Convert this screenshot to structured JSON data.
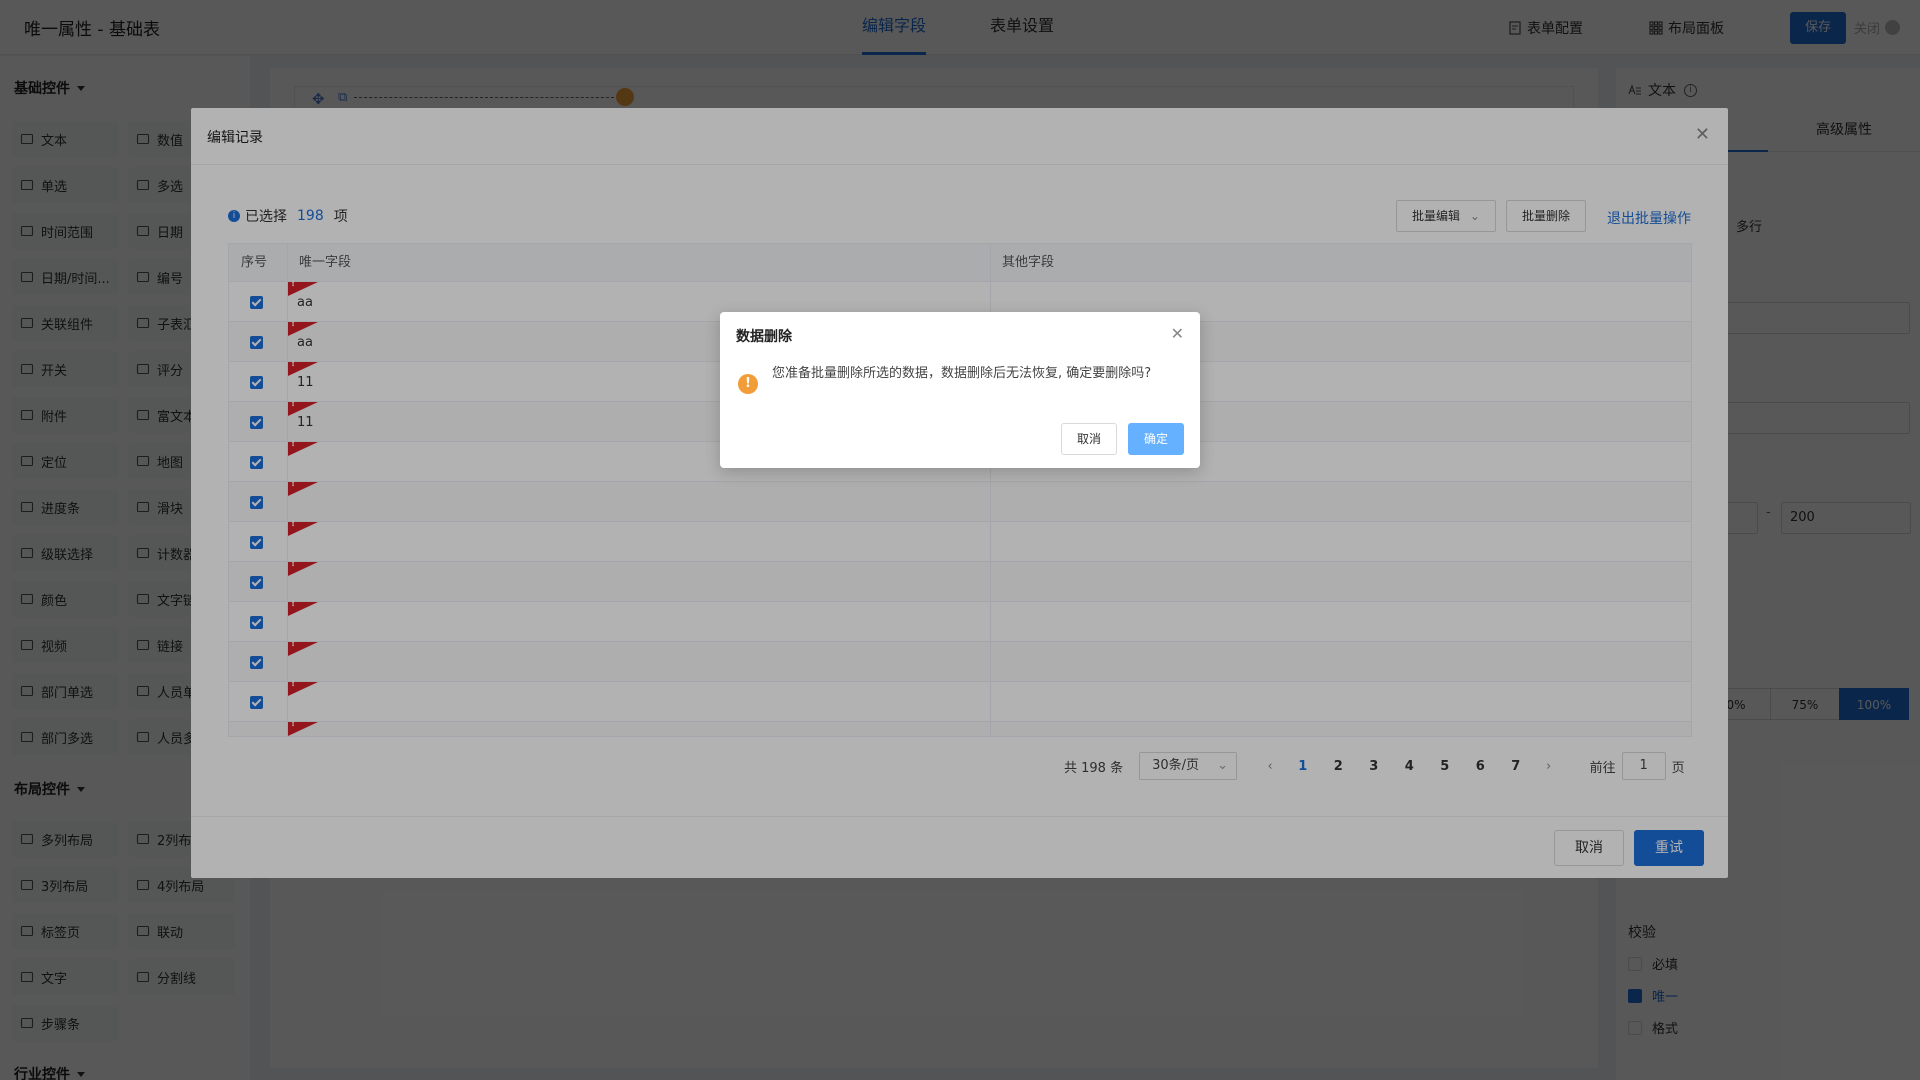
{
  "app": {
    "title": "唯一属性 - 基础表"
  },
  "header": {
    "tabs": [
      {
        "label": "编辑字段",
        "active": true
      },
      {
        "label": "表单设置",
        "active": false
      }
    ],
    "form_config": "表单配置",
    "layout_panel": "布局面板",
    "save": "保存",
    "close": "关闭"
  },
  "sidebar": {
    "basic_title": "基础控件",
    "basic": [
      {
        "label": "文本",
        "icon": "text-icon"
      },
      {
        "label": "数值",
        "icon": "number-icon"
      },
      {
        "label": "单选",
        "icon": "radio-icon"
      },
      {
        "label": "多选",
        "icon": "checkbox-icon"
      },
      {
        "label": "时间范围",
        "icon": "clock-icon"
      },
      {
        "label": "日期",
        "icon": "clock-icon"
      },
      {
        "label": "日期/时间...",
        "icon": "calendar-icon"
      },
      {
        "label": "编号",
        "icon": "serial-icon"
      },
      {
        "label": "关联组件",
        "icon": "link-component-icon"
      },
      {
        "label": "子表汇",
        "icon": "sigma-icon"
      },
      {
        "label": "开关",
        "icon": "toggle-icon"
      },
      {
        "label": "评分",
        "icon": "star-icon"
      },
      {
        "label": "附件",
        "icon": "paperclip-icon"
      },
      {
        "label": "富文本",
        "icon": "rich-text-icon"
      },
      {
        "label": "定位",
        "icon": "location-icon"
      },
      {
        "label": "地图",
        "icon": "map-icon"
      },
      {
        "label": "进度条",
        "icon": "progress-icon"
      },
      {
        "label": "滑块",
        "icon": "slider-icon"
      },
      {
        "label": "级联选择",
        "icon": "cascade-icon"
      },
      {
        "label": "计数器",
        "icon": "counter-icon"
      },
      {
        "label": "颜色",
        "icon": "pen-icon"
      },
      {
        "label": "文字链",
        "icon": "text-icon"
      },
      {
        "label": "视频",
        "icon": "video-icon"
      },
      {
        "label": "链接",
        "icon": "link-icon"
      },
      {
        "label": "部门单选",
        "icon": "department-icon"
      },
      {
        "label": "人员单",
        "icon": "person-icon"
      },
      {
        "label": "部门多选",
        "icon": "department-icon"
      },
      {
        "label": "人员多",
        "icon": "people-icon"
      }
    ],
    "layout_title": "布局控件",
    "layout": [
      {
        "label": "多列布局",
        "icon": "columns-icon"
      },
      {
        "label": "2列布",
        "icon": "two-columns-icon"
      },
      {
        "label": "3列布局",
        "icon": "three-columns-icon"
      },
      {
        "label": "4列布局",
        "icon": "four-columns-icon"
      },
      {
        "label": "标签页",
        "icon": "tabs-icon"
      },
      {
        "label": "联动",
        "icon": "grid-icon"
      },
      {
        "label": "文字",
        "icon": "letter-t-icon"
      },
      {
        "label": "分割线",
        "icon": "divider-icon"
      },
      {
        "label": "步骤条",
        "icon": "steps-icon"
      }
    ],
    "industry_title": "行业控件"
  },
  "right_panel": {
    "field_title": "文本",
    "tab_advanced": "高级属性",
    "multiline": "多行",
    "range_max": "200",
    "range_sep": "-",
    "widths": [
      {
        "label": "0%",
        "active": false
      },
      {
        "label": "75%",
        "active": false
      },
      {
        "label": "100%",
        "active": true
      }
    ],
    "validation_title": "校验",
    "validations": [
      {
        "label": "必填",
        "checked": false
      },
      {
        "label": "唯一",
        "checked": true
      },
      {
        "label": "格式",
        "checked": false
      }
    ]
  },
  "edit_modal": {
    "title": "编辑记录",
    "selected_prefix": "已选择",
    "selected_count": "198",
    "selected_suffix": "项",
    "batch_edit": "批量编辑",
    "batch_delete": "批量删除",
    "exit_batch": "退出批量操作",
    "columns": [
      "序号",
      "唯一字段",
      "其他字段"
    ],
    "rows": [
      {
        "value": "aa",
        "checked": true
      },
      {
        "value": "aa",
        "checked": true
      },
      {
        "value": "11",
        "checked": true
      },
      {
        "value": "11",
        "checked": true
      },
      {
        "value": "",
        "checked": true
      },
      {
        "value": "",
        "checked": true
      },
      {
        "value": "",
        "checked": true
      },
      {
        "value": "",
        "checked": true
      },
      {
        "value": "",
        "checked": true
      },
      {
        "value": "",
        "checked": true
      },
      {
        "value": "",
        "checked": true
      },
      {
        "value": "",
        "checked": true
      }
    ],
    "pager": {
      "total": "共 198 条",
      "page_size": "30条/页",
      "pages": [
        "1",
        "2",
        "3",
        "4",
        "5",
        "6",
        "7"
      ],
      "current": "1",
      "goto_label": "前往",
      "goto_value": "1",
      "goto_suffix": "页"
    },
    "cancel": "取消",
    "retry": "重试"
  },
  "confirm_dialog": {
    "title": "数据删除",
    "message": "您准备批量删除所选的数据，数据删除后无法恢复, 确定要删除吗?",
    "cancel": "取消",
    "ok": "确定"
  },
  "colors": {
    "accent": "#1e6fd9",
    "warning": "#f29d38",
    "error_flag": "#d4202a",
    "confirm_button": "#66b1ff"
  }
}
